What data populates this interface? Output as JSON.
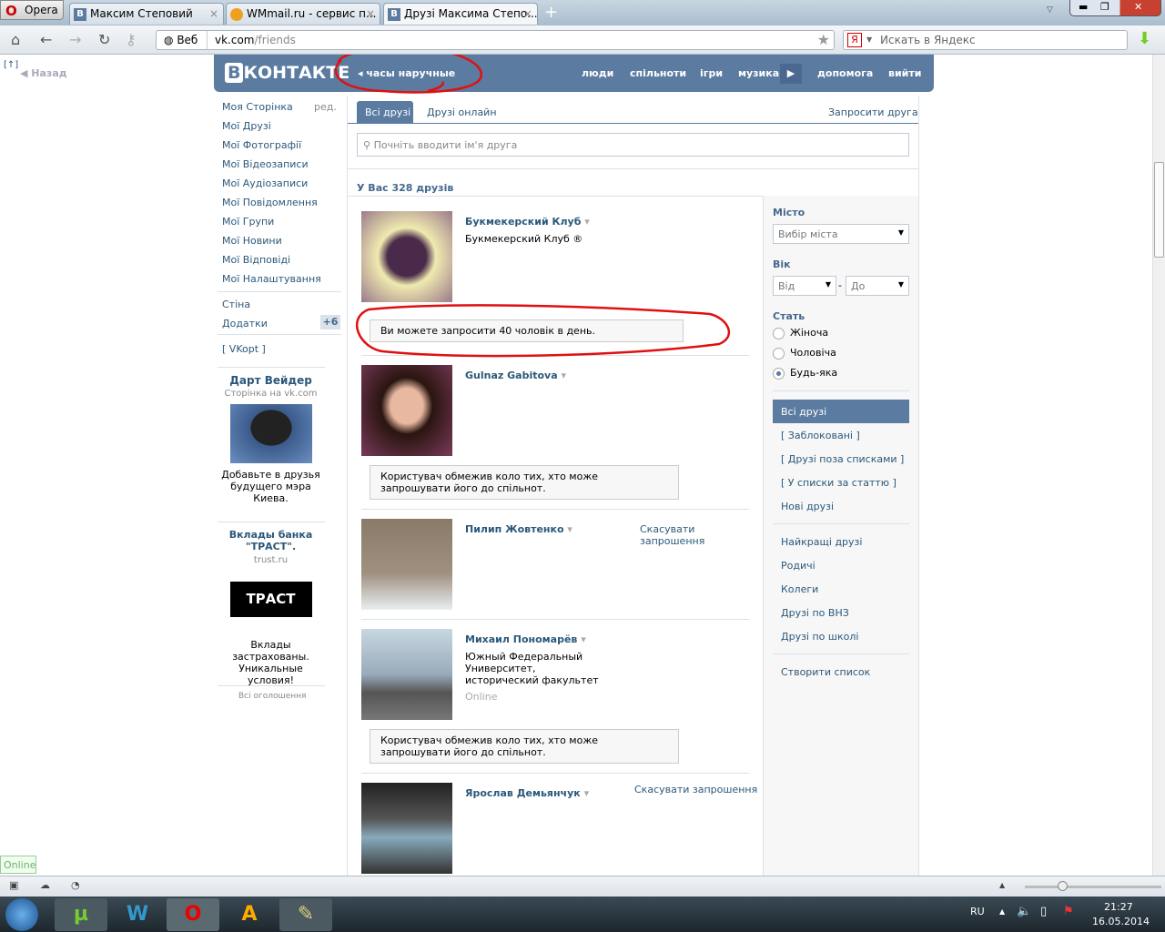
{
  "browser": {
    "menu_label": "Opera",
    "tabs": [
      {
        "label": "Максим Степовий"
      },
      {
        "label": "WMmail.ru - сервис п..."
      },
      {
        "label": "Друзі Максима Степо..."
      }
    ],
    "url_domain": "vk.com",
    "url_path": "/friends",
    "web_label": "Веб",
    "search_placeholder": "Искать в Яндекс",
    "back_label": "Назад",
    "up_label": "[↑]"
  },
  "vk": {
    "logo": "ВКонтакте",
    "crumb": "часы наручные",
    "nav": [
      "люди",
      "спільноти",
      "ігри",
      "музика",
      "допомога",
      "вийти"
    ],
    "sidebar": {
      "items": [
        "Моя Сторінка",
        "Мої Друзі",
        "Мої Фотографії",
        "Мої Відеозаписи",
        "Мої Аудіозаписи",
        "Мої Повідомлення",
        "Мої Групи",
        "Мої Новини",
        "Мої Відповіді",
        "Мої Налаштування"
      ],
      "edit": "ред.",
      "wall": "Стіна",
      "apps": "Додатки",
      "apps_badge": "+6",
      "vkopt": "[ VKopt ]"
    },
    "ads": [
      {
        "title": "Дарт Вейдер",
        "sub": "Сторінка на vk.com",
        "text": "Добавьте в друзья будущего мэра Киева."
      },
      {
        "title": "Вклады банка \"ТРАСТ\".",
        "sub": "trust.ru",
        "logo": "ТРАСТ",
        "text": "Вклады застрахованы. Уникальные условия!"
      }
    ],
    "all_ads": "Всі оголошення",
    "tabs": [
      "Всі друзі",
      "Друзі онлайн"
    ],
    "invite": "Запросити друга",
    "search_placeholder": "Почніть вводити ім'я друга",
    "count": "У Вас 328 друзів",
    "friends": [
      {
        "name": "Букмекерский Клуб",
        "info": "Букмекерский Клуб ®",
        "note": "Ви можете запросити 40 чоловік в день."
      },
      {
        "name": "Gulnaz Gabitova",
        "note": "Користувач обмежив коло тих, хто може запрошувати його до спільнот."
      },
      {
        "name": "Пилип Жовтенко",
        "action": "Скасувати запрошення"
      },
      {
        "name": "Михаил Пономарёв",
        "info": "Южный Федеральный Университет, исторический факультет",
        "status": "Online",
        "note": "Користувач обмежив коло тих, хто може запрошувати його до спільнот."
      },
      {
        "name": "Ярослав Демьянчук",
        "action": "Скасувати запрошення"
      }
    ],
    "filters": {
      "city_label": "Місто",
      "city": "Вибір міста",
      "age_label": "Вік",
      "from": "Від",
      "to": "До",
      "sex_label": "Стать",
      "sex": [
        "Жіноча",
        "Чоловіча",
        "Будь-яка"
      ],
      "sex_selected": "Будь-яка",
      "lists": [
        "Всі друзі",
        "[ Заблоковані ]",
        "[ Друзі поза списками ]",
        "[ У списки за статтю ]",
        "Нові друзі"
      ],
      "groups": [
        "Найкращі друзі",
        "Родичі",
        "Колеги",
        "Друзі по ВНЗ",
        "Друзі по школі"
      ],
      "create": "Створити список"
    }
  },
  "status": {
    "online": "Online"
  },
  "taskbar": {
    "lang": "RU",
    "time": "21:27",
    "date": "16.05.2014"
  },
  "colors": {
    "vk_blue": "#5b7ba1",
    "link": "#2b587a",
    "annotation": "#e01010"
  }
}
